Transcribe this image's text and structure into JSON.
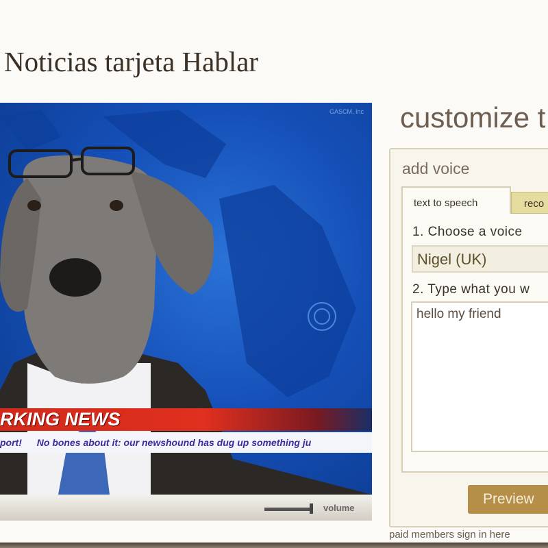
{
  "page_title": "Noticias tarjeta Hablar",
  "video": {
    "watermark": "GASCM, Inc",
    "headline": "BREAKING NEWS",
    "headline_visible": "RKING NEWS",
    "ticker": [
      "port!",
      "No bones about it: our newshound has dug up something ju"
    ],
    "volume_label": "volume",
    "volume_level": 0.9
  },
  "customize": {
    "title": "customize t",
    "section": "add voice",
    "tabs": [
      {
        "label": "text to speech",
        "active": true
      },
      {
        "label": "reco",
        "active": false
      }
    ],
    "step1": "1. Choose a voice",
    "voice": "Nigel (UK)",
    "step2": "2. Type what you w",
    "message": "hello my friend",
    "preview_label": "Preview",
    "paid_link": "paid members sign in here"
  },
  "colors": {
    "accent": "#b58e48",
    "news_red": "#d22a1a",
    "ticker_text": "#3a2c9c"
  }
}
